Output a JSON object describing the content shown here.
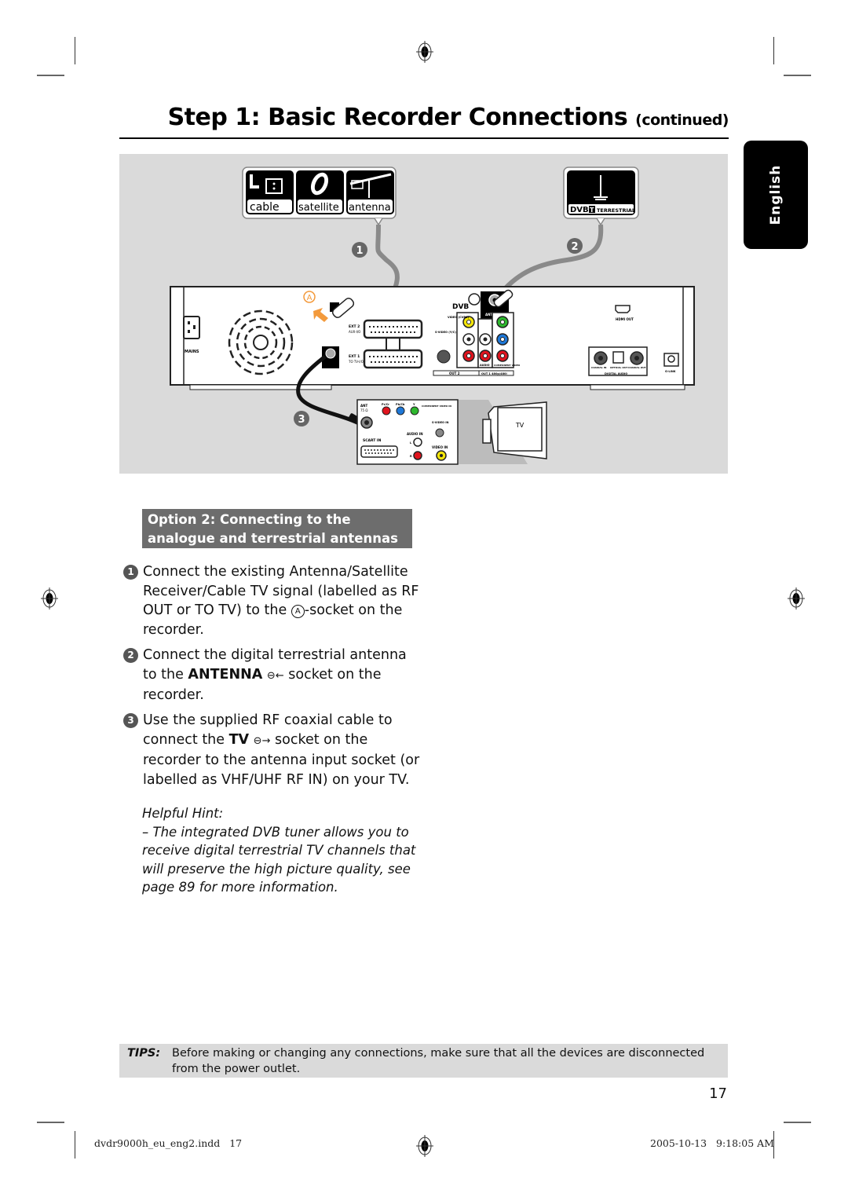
{
  "page": {
    "title_main": "Step 1: Basic Recorder Connections",
    "title_suffix": "(continued)",
    "language_tab": "English",
    "page_number": "17"
  },
  "figure": {
    "source_box": {
      "labels": [
        "cable",
        "satellite",
        "antenna"
      ],
      "icons": [
        "cable-box-icon",
        "satellite-dish-icon",
        "rooftop-antenna-icon"
      ]
    },
    "dvb_box": {
      "logo": "DVB",
      "logo_t": "T",
      "label": "TERRESTRIAL"
    },
    "callouts": [
      "1",
      "2",
      "3"
    ],
    "socket_marker": "A",
    "recorder_labels": {
      "mains": "MAINS",
      "ext2": "EXT 2",
      "ext2_sub": "AUX-I/O",
      "ext1": "EXT 1",
      "ext1_sub": "TO TV-I/O",
      "antenna": "ANTENNA",
      "video_cvbs": "VIDEO (CVBS)",
      "svideo": "S-VIDEO (Y/C)",
      "audio_small": "AUDIO",
      "audio": "AUDIO",
      "component": "COMPONENT VIDEO",
      "out2": "OUT 2",
      "out1": "OUT 1  480p/480i",
      "hdmi": "HDMI OUT",
      "coaxial_in": "COAXIAL IN",
      "optical_out": "OPTICAL OUT",
      "coaxial_out": "COAXIAL OUT",
      "digital_audio": "DIGITAL AUDIO",
      "glink": "G-LINK"
    },
    "tv_panel_labels": {
      "ant": "ANT",
      "ant_sub": "75 Ω",
      "pr": "Pr/Cr",
      "pb": "Pb/Cb",
      "y": "Y",
      "component_in": "COMPONENT VIDEO IN",
      "svideo_in": "S-VIDEO IN",
      "audio_in": "AUDIO IN",
      "l": "L",
      "r": "R",
      "scart_in": "SCART IN",
      "video_in": "VIDEO IN",
      "tv": "TV"
    },
    "colors": {
      "background": "#dadada",
      "accent_orange": "#f39a3c",
      "yellow": "#f4e60a",
      "green": "#2eb82e",
      "blue": "#1e78d8",
      "red": "#e0141e"
    }
  },
  "option": {
    "heading_line1": "Option 2: Connecting to the",
    "heading_line2": "analogue and terrestrial antennas"
  },
  "steps": [
    {
      "num": "1",
      "text_before": "Connect the existing Antenna/Satellite Receiver/Cable TV signal (labelled as RF OUT or TO TV) to the ",
      "marker": "A",
      "text_after": "-socket on the recorder."
    },
    {
      "num": "2",
      "text_before": "Connect the digital terrestrial antenna to the ",
      "bold": "ANTENNA",
      "symbol": "⊖←",
      "text_after": " socket on the recorder."
    },
    {
      "num": "3",
      "text_before": "Use the supplied RF coaxial cable to connect the ",
      "bold": "TV",
      "symbol": "⊖→",
      "text_after": " socket on the recorder to the antenna input socket (or labelled as VHF/UHF RF IN) on your TV."
    }
  ],
  "hint": {
    "title": "Helpful Hint:",
    "text": "– The integrated DVB tuner allows you to receive digital terrestrial TV channels that will preserve the high picture quality, see page 89 for more information."
  },
  "tips": {
    "label": "TIPS:",
    "text": "Before making or changing any connections, make sure that all the devices are disconnected from the power outlet."
  },
  "slug": {
    "file": "dvdr9000h_eu_eng2.indd   17",
    "timestamp": "2005-10-13   9:18:05 AM"
  }
}
